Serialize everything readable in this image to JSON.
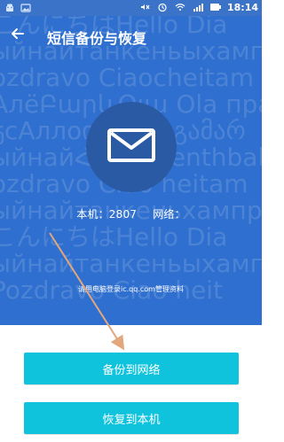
{
  "statusbar": {
    "time": "18:14",
    "icons": [
      "android-icon",
      "image-icon",
      "alarm-icon",
      "wifi-icon",
      "signal-icon",
      "battery-icon"
    ]
  },
  "header": {
    "title": "短信备份与恢复",
    "back_icon": "back-arrow-icon"
  },
  "hero": {
    "mail_icon": "mail-icon",
    "stats_text": "本机：2807",
    "stats_network_text": "网络：",
    "hint": "请用电脑登录ic.qq.com管理资料",
    "bg_lines": [
      "こんにちはHello Dia",
      "ыйнайтанкеньыхамп",
      "ozdravo Ciaocheitam",
      "АлёԲարևՕլա Ola пра",
      "ҕсАллоიბოლოგამარ",
      "ыйнайՀայ Dzienthbah",
      "ozdravo Ciao heitam",
      "ыйнайтанкеньхампра",
      "こんにちはHello Dia",
      "ыйнайтанкеньыхамп",
      "Pozdravo Ciao heit"
    ]
  },
  "actions": {
    "backup_label": "备份到网络",
    "restore_label": "恢复到本机"
  },
  "colors": {
    "header_blue": "#3b73c8",
    "hero_blue": "#2f6fcf",
    "circle_blue": "#2a5aa3",
    "button_teal": "#10c3dc",
    "arrow_brown": "#e2a77a"
  }
}
